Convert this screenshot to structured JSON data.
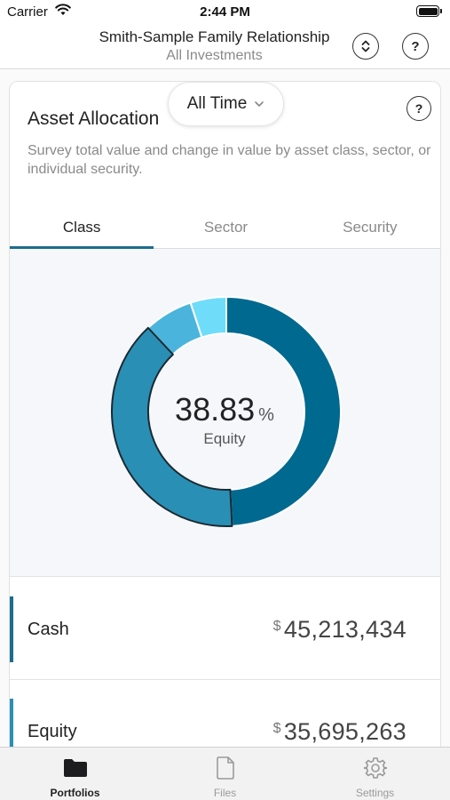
{
  "status_bar": {
    "carrier": "Carrier",
    "time": "2:44 PM"
  },
  "header": {
    "title": "Smith-Sample Family Relationship",
    "subtitle": "All Investments",
    "switch_icon": "chevron-up-down-icon",
    "help_label": "?"
  },
  "card": {
    "title": "Asset Allocation",
    "help_label": "?",
    "description": "Survey total value and change in value by asset class, sector, or individual security.",
    "period": "All Time"
  },
  "tabs": [
    {
      "label": "Class",
      "active": true
    },
    {
      "label": "Sector",
      "active": false
    },
    {
      "label": "Security",
      "active": false
    }
  ],
  "chart_data": {
    "type": "pie",
    "donut": true,
    "center_value": "38.83",
    "center_unit": "%",
    "center_label": "Equity",
    "slices": [
      {
        "value": 49.2,
        "color": "#00698f"
      },
      {
        "value": 38.83,
        "color": "#2a8fb5",
        "highlighted": true
      },
      {
        "value": 6.9,
        "color": "#4bb4dc"
      },
      {
        "value": 5.07,
        "color": "#6fdcfa"
      }
    ]
  },
  "list": [
    {
      "label": "Cash",
      "currency": "$",
      "amount": "45,213,434",
      "color": "#1c6d8f"
    },
    {
      "label": "Equity",
      "currency": "$",
      "amount": "35,695,263",
      "color": "#2a8fb5"
    }
  ],
  "tab_bar": [
    {
      "label": "Portfolios",
      "icon": "folder-icon",
      "active": true
    },
    {
      "label": "Files",
      "icon": "file-icon",
      "active": false
    },
    {
      "label": "Settings",
      "icon": "gear-icon",
      "active": false
    }
  ],
  "colors": {
    "accent": "#1c6d8f",
    "background": "#f5f7fa"
  }
}
